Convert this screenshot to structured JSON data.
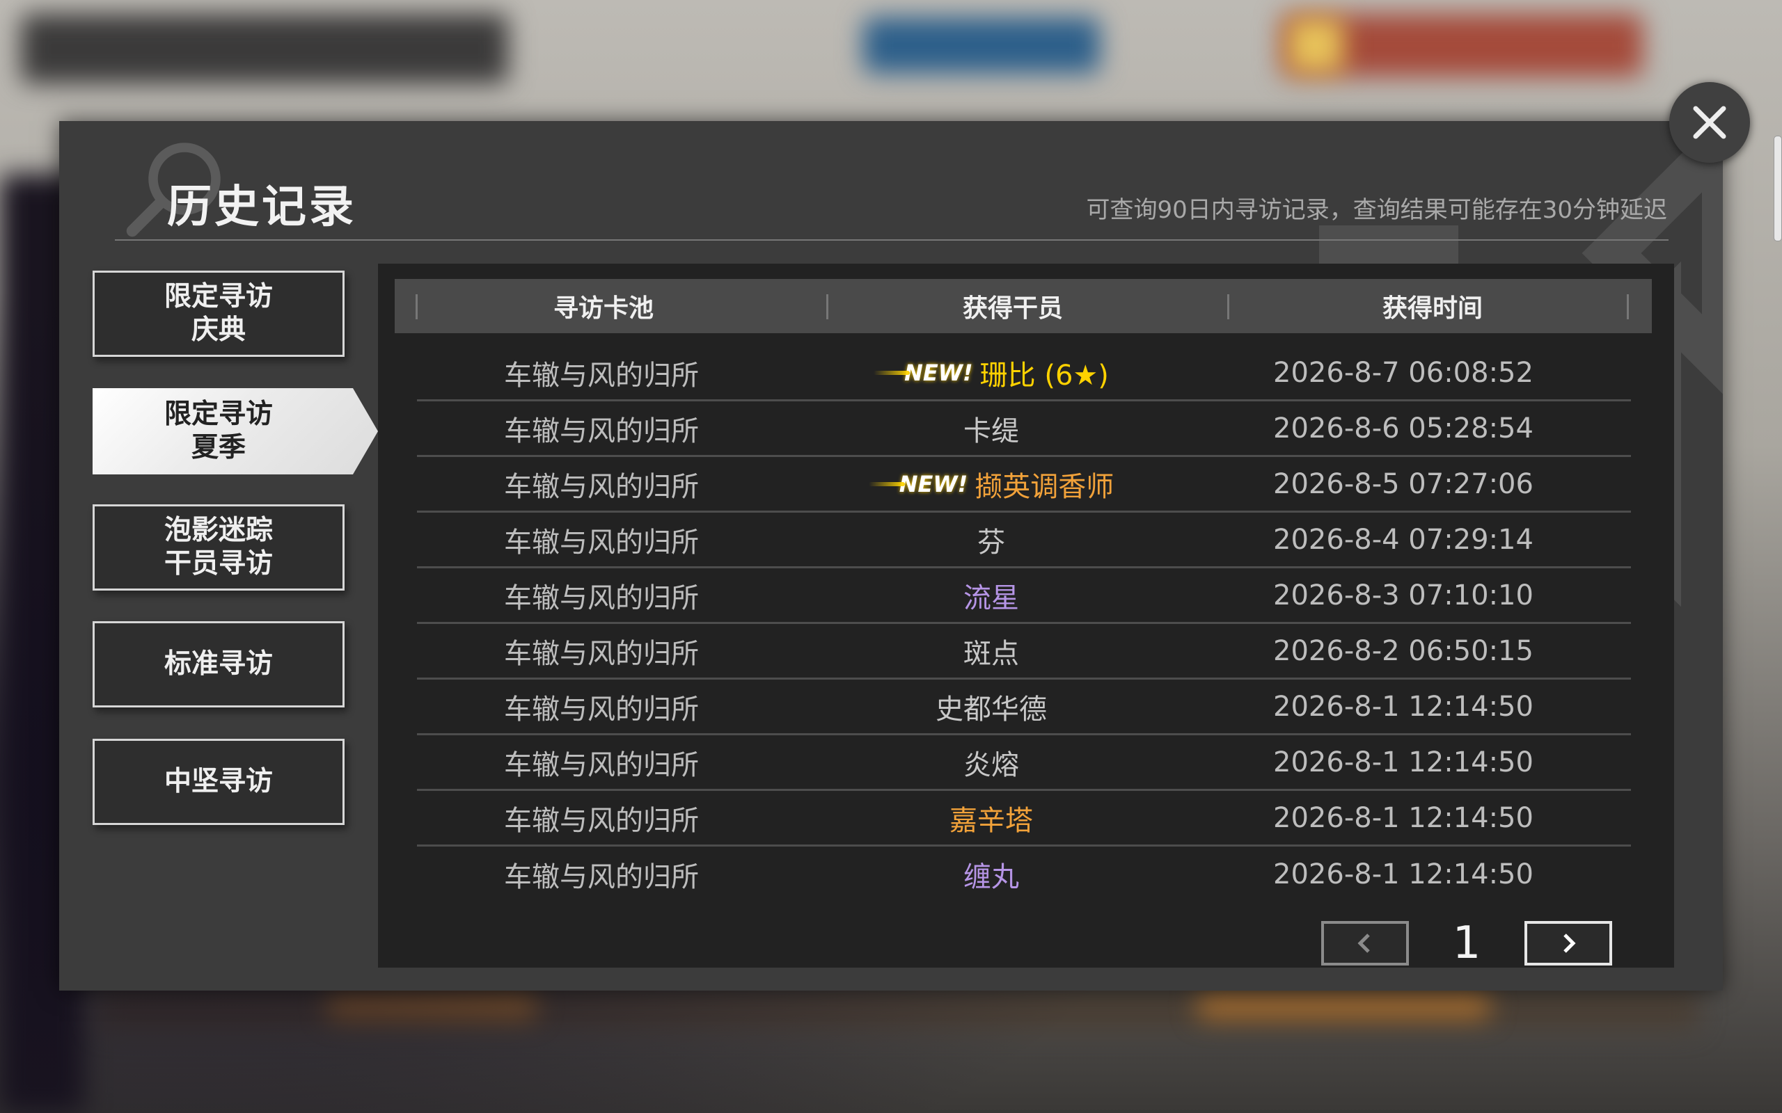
{
  "window": {
    "title": "历史记录",
    "subtitle": "可查询90日内寻访记录，查询结果可能存在30分钟延迟"
  },
  "tabs": [
    {
      "label": "限定寻访\n庆典",
      "active": false
    },
    {
      "label": "限定寻访\n夏季",
      "active": true
    },
    {
      "label": "泡影迷踪\n干员寻访",
      "active": false
    },
    {
      "label": "标准寻访",
      "active": false
    },
    {
      "label": "中坚寻访",
      "active": false
    }
  ],
  "table": {
    "headers": [
      "寻访卡池",
      "获得干员",
      "获得时间"
    ],
    "new_badge": "NEW!",
    "rows": [
      {
        "pool": "车辙与风的归所",
        "operator": "珊比 (6★)",
        "time": "2026-8-7 06:08:52",
        "rarity": 6,
        "is_new": true
      },
      {
        "pool": "车辙与风的归所",
        "operator": "卡缇",
        "time": "2026-8-6 05:28:54",
        "rarity": 3,
        "is_new": false
      },
      {
        "pool": "车辙与风的归所",
        "operator": "撷英调香师",
        "time": "2026-8-5 07:27:06",
        "rarity": 5,
        "is_new": true
      },
      {
        "pool": "车辙与风的归所",
        "operator": "芬",
        "time": "2026-8-4 07:29:14",
        "rarity": 3,
        "is_new": false
      },
      {
        "pool": "车辙与风的归所",
        "operator": "流星",
        "time": "2026-8-3 07:10:10",
        "rarity": 4,
        "is_new": false
      },
      {
        "pool": "车辙与风的归所",
        "operator": "斑点",
        "time": "2026-8-2 06:50:15",
        "rarity": 3,
        "is_new": false
      },
      {
        "pool": "车辙与风的归所",
        "operator": "史都华德",
        "time": "2026-8-1 12:14:50",
        "rarity": 3,
        "is_new": false
      },
      {
        "pool": "车辙与风的归所",
        "operator": "炎熔",
        "time": "2026-8-1 12:14:50",
        "rarity": 3,
        "is_new": false
      },
      {
        "pool": "车辙与风的归所",
        "operator": "嘉辛塔",
        "time": "2026-8-1 12:14:50",
        "rarity": 5,
        "is_new": false
      },
      {
        "pool": "车辙与风的归所",
        "operator": "缠丸",
        "time": "2026-8-1 12:14:50",
        "rarity": 4,
        "is_new": false
      }
    ]
  },
  "rarity_colors": {
    "6": "#ffd200",
    "5": "#f2a23a",
    "4": "#b695e6",
    "3": "#c8c8c8"
  },
  "pager": {
    "page": "1",
    "prev_icon": "chevron-left-icon",
    "next_icon": "chevron-right-icon"
  },
  "close_icon": "close-icon"
}
